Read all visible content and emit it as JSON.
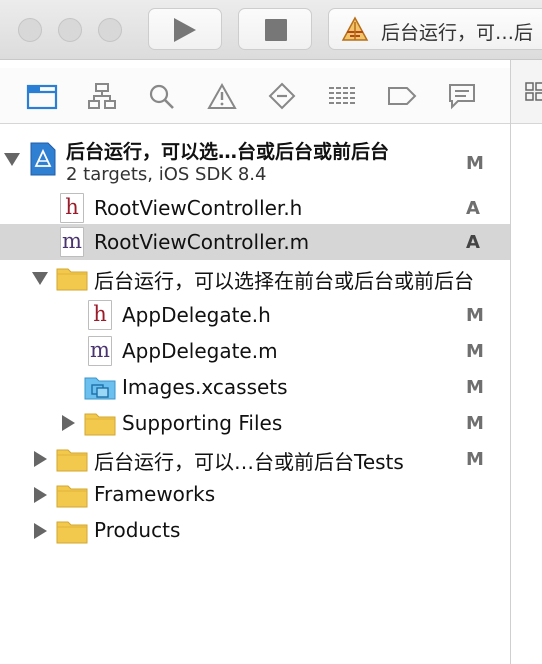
{
  "toolbar": {
    "scheme_label": "后台运行，可…后"
  },
  "navigator_tabs": [
    {
      "name": "project-navigator-icon",
      "active": true
    },
    {
      "name": "symbol-navigator-icon"
    },
    {
      "name": "find-navigator-icon"
    },
    {
      "name": "issue-navigator-icon"
    },
    {
      "name": "test-navigator-icon"
    },
    {
      "name": "debug-navigator-icon"
    },
    {
      "name": "breakpoint-navigator-icon"
    },
    {
      "name": "report-navigator-icon"
    }
  ],
  "project": {
    "title": "后台运行，可以选…台或后台或前后台",
    "subtitle": "2 targets, iOS SDK 8.4",
    "status": "M"
  },
  "files": {
    "root_h": {
      "label": "RootViewController.h",
      "status": "A"
    },
    "root_m": {
      "label": "RootViewController.m",
      "status": "A"
    },
    "group_main": {
      "label": "后台运行，可以选择在前台或后台或前后台"
    },
    "app_h": {
      "label": "AppDelegate.h",
      "status": "M"
    },
    "app_m": {
      "label": "AppDelegate.m",
      "status": "M"
    },
    "images": {
      "label": "Images.xcassets",
      "status": "M"
    },
    "supporting": {
      "label": "Supporting Files",
      "status": "M"
    },
    "tests": {
      "label": "后台运行，可以…台或前后台Tests",
      "status": "M"
    },
    "frameworks": {
      "label": "Frameworks"
    },
    "products": {
      "label": "Products"
    }
  },
  "colors": {
    "accent": "#2a7fd4",
    "selection": "#d6d6d6",
    "folder": "#f2c94c"
  }
}
